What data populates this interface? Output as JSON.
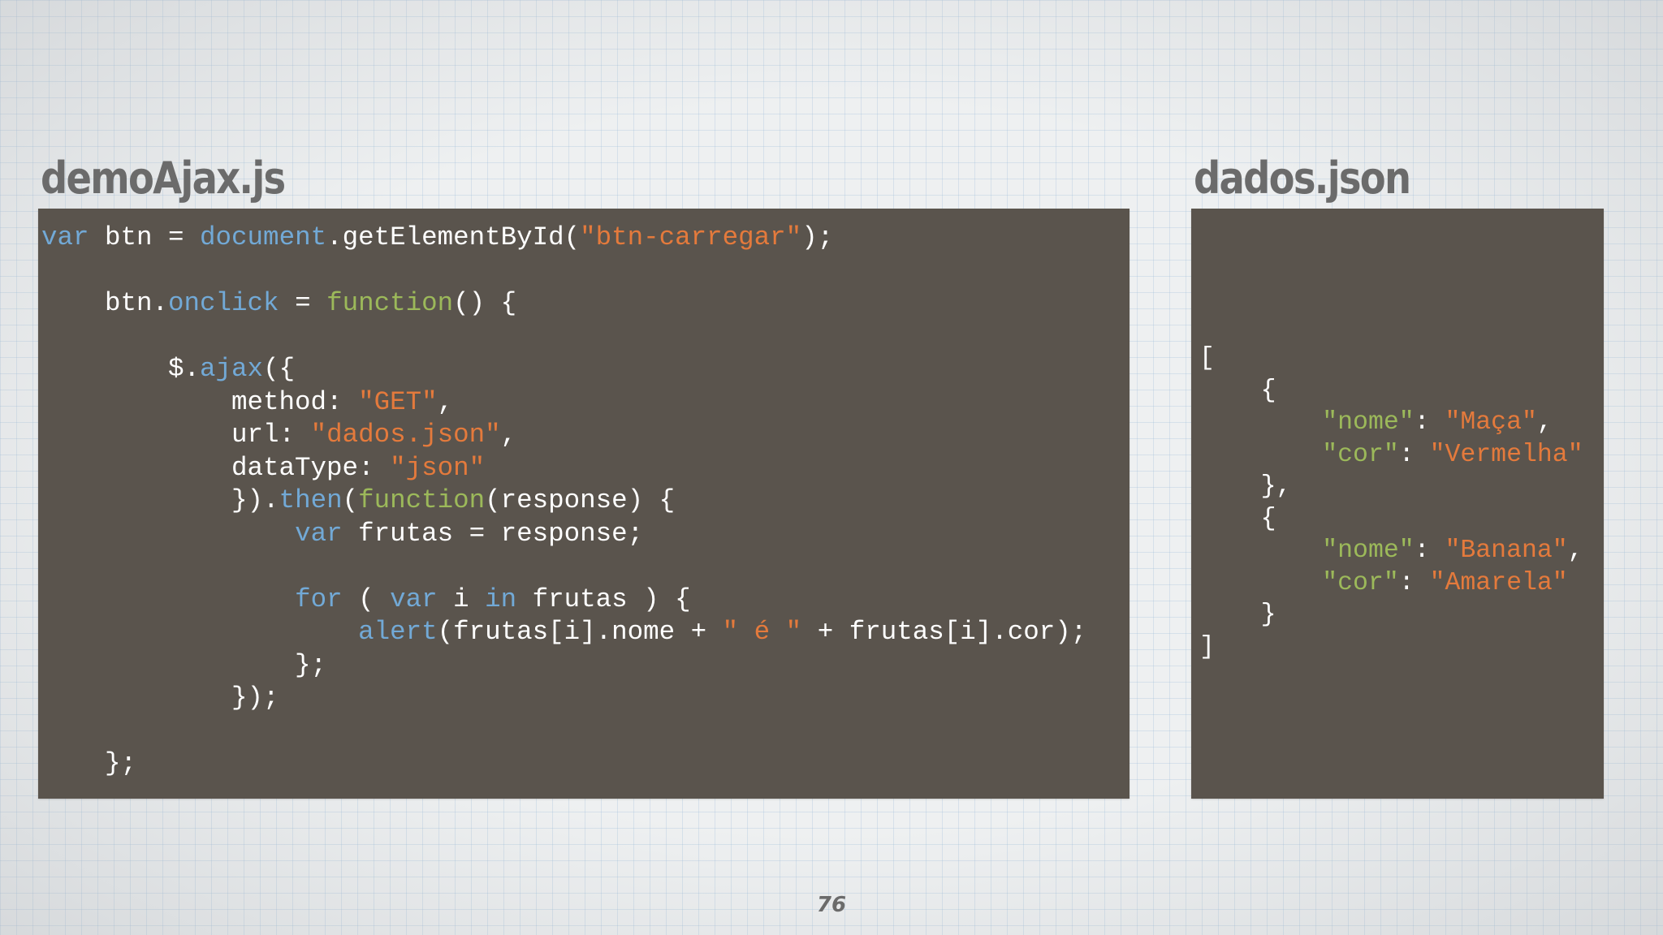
{
  "slide": {
    "left_title": "demoAjax.js",
    "right_title": "dados.json",
    "page_number": "76"
  },
  "colors": {
    "background": "#eef0f1",
    "panel": "#5a544d",
    "title": "#6b6b6b",
    "keyword": "#72a9d6",
    "function": "#9cb95a",
    "string": "#e47a3c",
    "text": "#ffffff"
  },
  "code_js": [
    [
      [
        "kw",
        "var"
      ],
      [
        "pn",
        " btn = "
      ],
      [
        "kw",
        "document"
      ],
      [
        "pn",
        ".getElementById("
      ],
      [
        "str",
        "\"btn-carregar\""
      ],
      [
        "pn",
        ");"
      ]
    ],
    [],
    [
      [
        "pn",
        "    btn."
      ],
      [
        "kw",
        "onclick"
      ],
      [
        "pn",
        " = "
      ],
      [
        "fn",
        "function"
      ],
      [
        "pn",
        "() {"
      ]
    ],
    [],
    [
      [
        "pn",
        "        $."
      ],
      [
        "kw",
        "ajax"
      ],
      [
        "pn",
        "({"
      ]
    ],
    [
      [
        "pn",
        "            method: "
      ],
      [
        "str",
        "\"GET\""
      ],
      [
        "pn",
        ","
      ]
    ],
    [
      [
        "pn",
        "            url: "
      ],
      [
        "str",
        "\"dados.json\""
      ],
      [
        "pn",
        ","
      ]
    ],
    [
      [
        "pn",
        "            dataType: "
      ],
      [
        "str",
        "\"json\""
      ]
    ],
    [
      [
        "pn",
        "            })."
      ],
      [
        "kw",
        "then"
      ],
      [
        "pn",
        "("
      ],
      [
        "fn",
        "function"
      ],
      [
        "pn",
        "(response) {"
      ]
    ],
    [
      [
        "pn",
        "                "
      ],
      [
        "kw",
        "var"
      ],
      [
        "pn",
        " frutas = response;"
      ]
    ],
    [],
    [
      [
        "pn",
        "                "
      ],
      [
        "kw",
        "for"
      ],
      [
        "pn",
        " ( "
      ],
      [
        "kw",
        "var"
      ],
      [
        "pn",
        " i "
      ],
      [
        "kw",
        "in"
      ],
      [
        "pn",
        " frutas ) {"
      ]
    ],
    [
      [
        "pn",
        "                    "
      ],
      [
        "kw",
        "alert"
      ],
      [
        "pn",
        "(frutas[i].nome + "
      ],
      [
        "str",
        "\" é \""
      ],
      [
        "pn",
        " + frutas[i].cor);"
      ]
    ],
    [
      [
        "pn",
        "                };"
      ]
    ],
    [
      [
        "pn",
        "            });"
      ]
    ],
    [],
    [
      [
        "pn",
        "    };"
      ]
    ]
  ],
  "code_json": [
    [
      [
        "pn",
        "["
      ]
    ],
    [
      [
        "pn",
        "    {"
      ]
    ],
    [
      [
        "pn",
        "        "
      ],
      [
        "key",
        "\"nome\""
      ],
      [
        "pn",
        ": "
      ],
      [
        "str",
        "\"Maça\""
      ],
      [
        "pn",
        ","
      ]
    ],
    [
      [
        "pn",
        "        "
      ],
      [
        "key",
        "\"cor\""
      ],
      [
        "pn",
        ": "
      ],
      [
        "str",
        "\"Vermelha\""
      ]
    ],
    [
      [
        "pn",
        "    },"
      ]
    ],
    [
      [
        "pn",
        "    {"
      ]
    ],
    [
      [
        "pn",
        "        "
      ],
      [
        "key",
        "\"nome\""
      ],
      [
        "pn",
        ": "
      ],
      [
        "str",
        "\"Banana\""
      ],
      [
        "pn",
        ","
      ]
    ],
    [
      [
        "pn",
        "        "
      ],
      [
        "key",
        "\"cor\""
      ],
      [
        "pn",
        ": "
      ],
      [
        "str",
        "\"Amarela\""
      ]
    ],
    [
      [
        "pn",
        "    }"
      ]
    ],
    [
      [
        "pn",
        "]"
      ]
    ]
  ]
}
